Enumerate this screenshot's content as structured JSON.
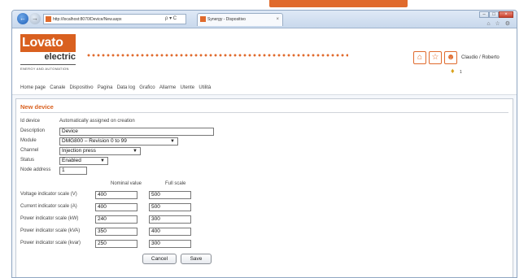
{
  "browser": {
    "address": "http://localhost:8070/Device/New.aspx",
    "address_tools": "ρ ▾ C",
    "tab_title": "Synergy - Dispositivo",
    "tab_close": "×",
    "back_glyph": "←",
    "forward_glyph": "→",
    "win_min": "–",
    "win_max": "□",
    "win_close": "×",
    "tools": "⌂ ☆ ⚙"
  },
  "header": {
    "logo_main": "Lovato",
    "logo_sub": "electric",
    "logo_tagline": "ENERGY AND AUTOMATION",
    "user": "Claudio / Roberto",
    "notification_count": "1",
    "icons": [
      "home-icon",
      "star-icon",
      "user-icon",
      "bell-icon"
    ]
  },
  "menu": [
    "Home page",
    "Canale",
    "Dispositivo",
    "Pagina",
    "Data log",
    "Grafico",
    "Allarme",
    "Utente",
    "Utilità"
  ],
  "form": {
    "title": "New device",
    "id_device": {
      "label": "Id device",
      "value": "Automatically assigned on creation"
    },
    "description": {
      "label": "Description",
      "value": "Device"
    },
    "module": {
      "label": "Module",
      "value": "DMG800 – Revision 0 to 99"
    },
    "channel": {
      "label": "Channel",
      "value": "Injection press"
    },
    "status": {
      "label": "Status",
      "value": "Enabled"
    },
    "node_address": {
      "label": "Node address",
      "value": "1"
    },
    "scales": {
      "nominal_header": "Nominal value",
      "full_header": "Full scale",
      "rows": [
        {
          "label": "Voltage indicator scale (V)",
          "nominal": "400",
          "full": "500"
        },
        {
          "label": "Current indicator scale (A)",
          "nominal": "400",
          "full": "500"
        },
        {
          "label": "Power indicator scale (kW)",
          "nominal": "240",
          "full": "300"
        },
        {
          "label": "Power indicator scale (kVA)",
          "nominal": "350",
          "full": "400"
        },
        {
          "label": "Power indicator scale (kvar)",
          "nominal": "250",
          "full": "300"
        }
      ]
    },
    "cancel_label": "Cancel",
    "save_label": "Save"
  },
  "colors": {
    "accent": "#e06a2c",
    "logo": "#d9601f"
  }
}
